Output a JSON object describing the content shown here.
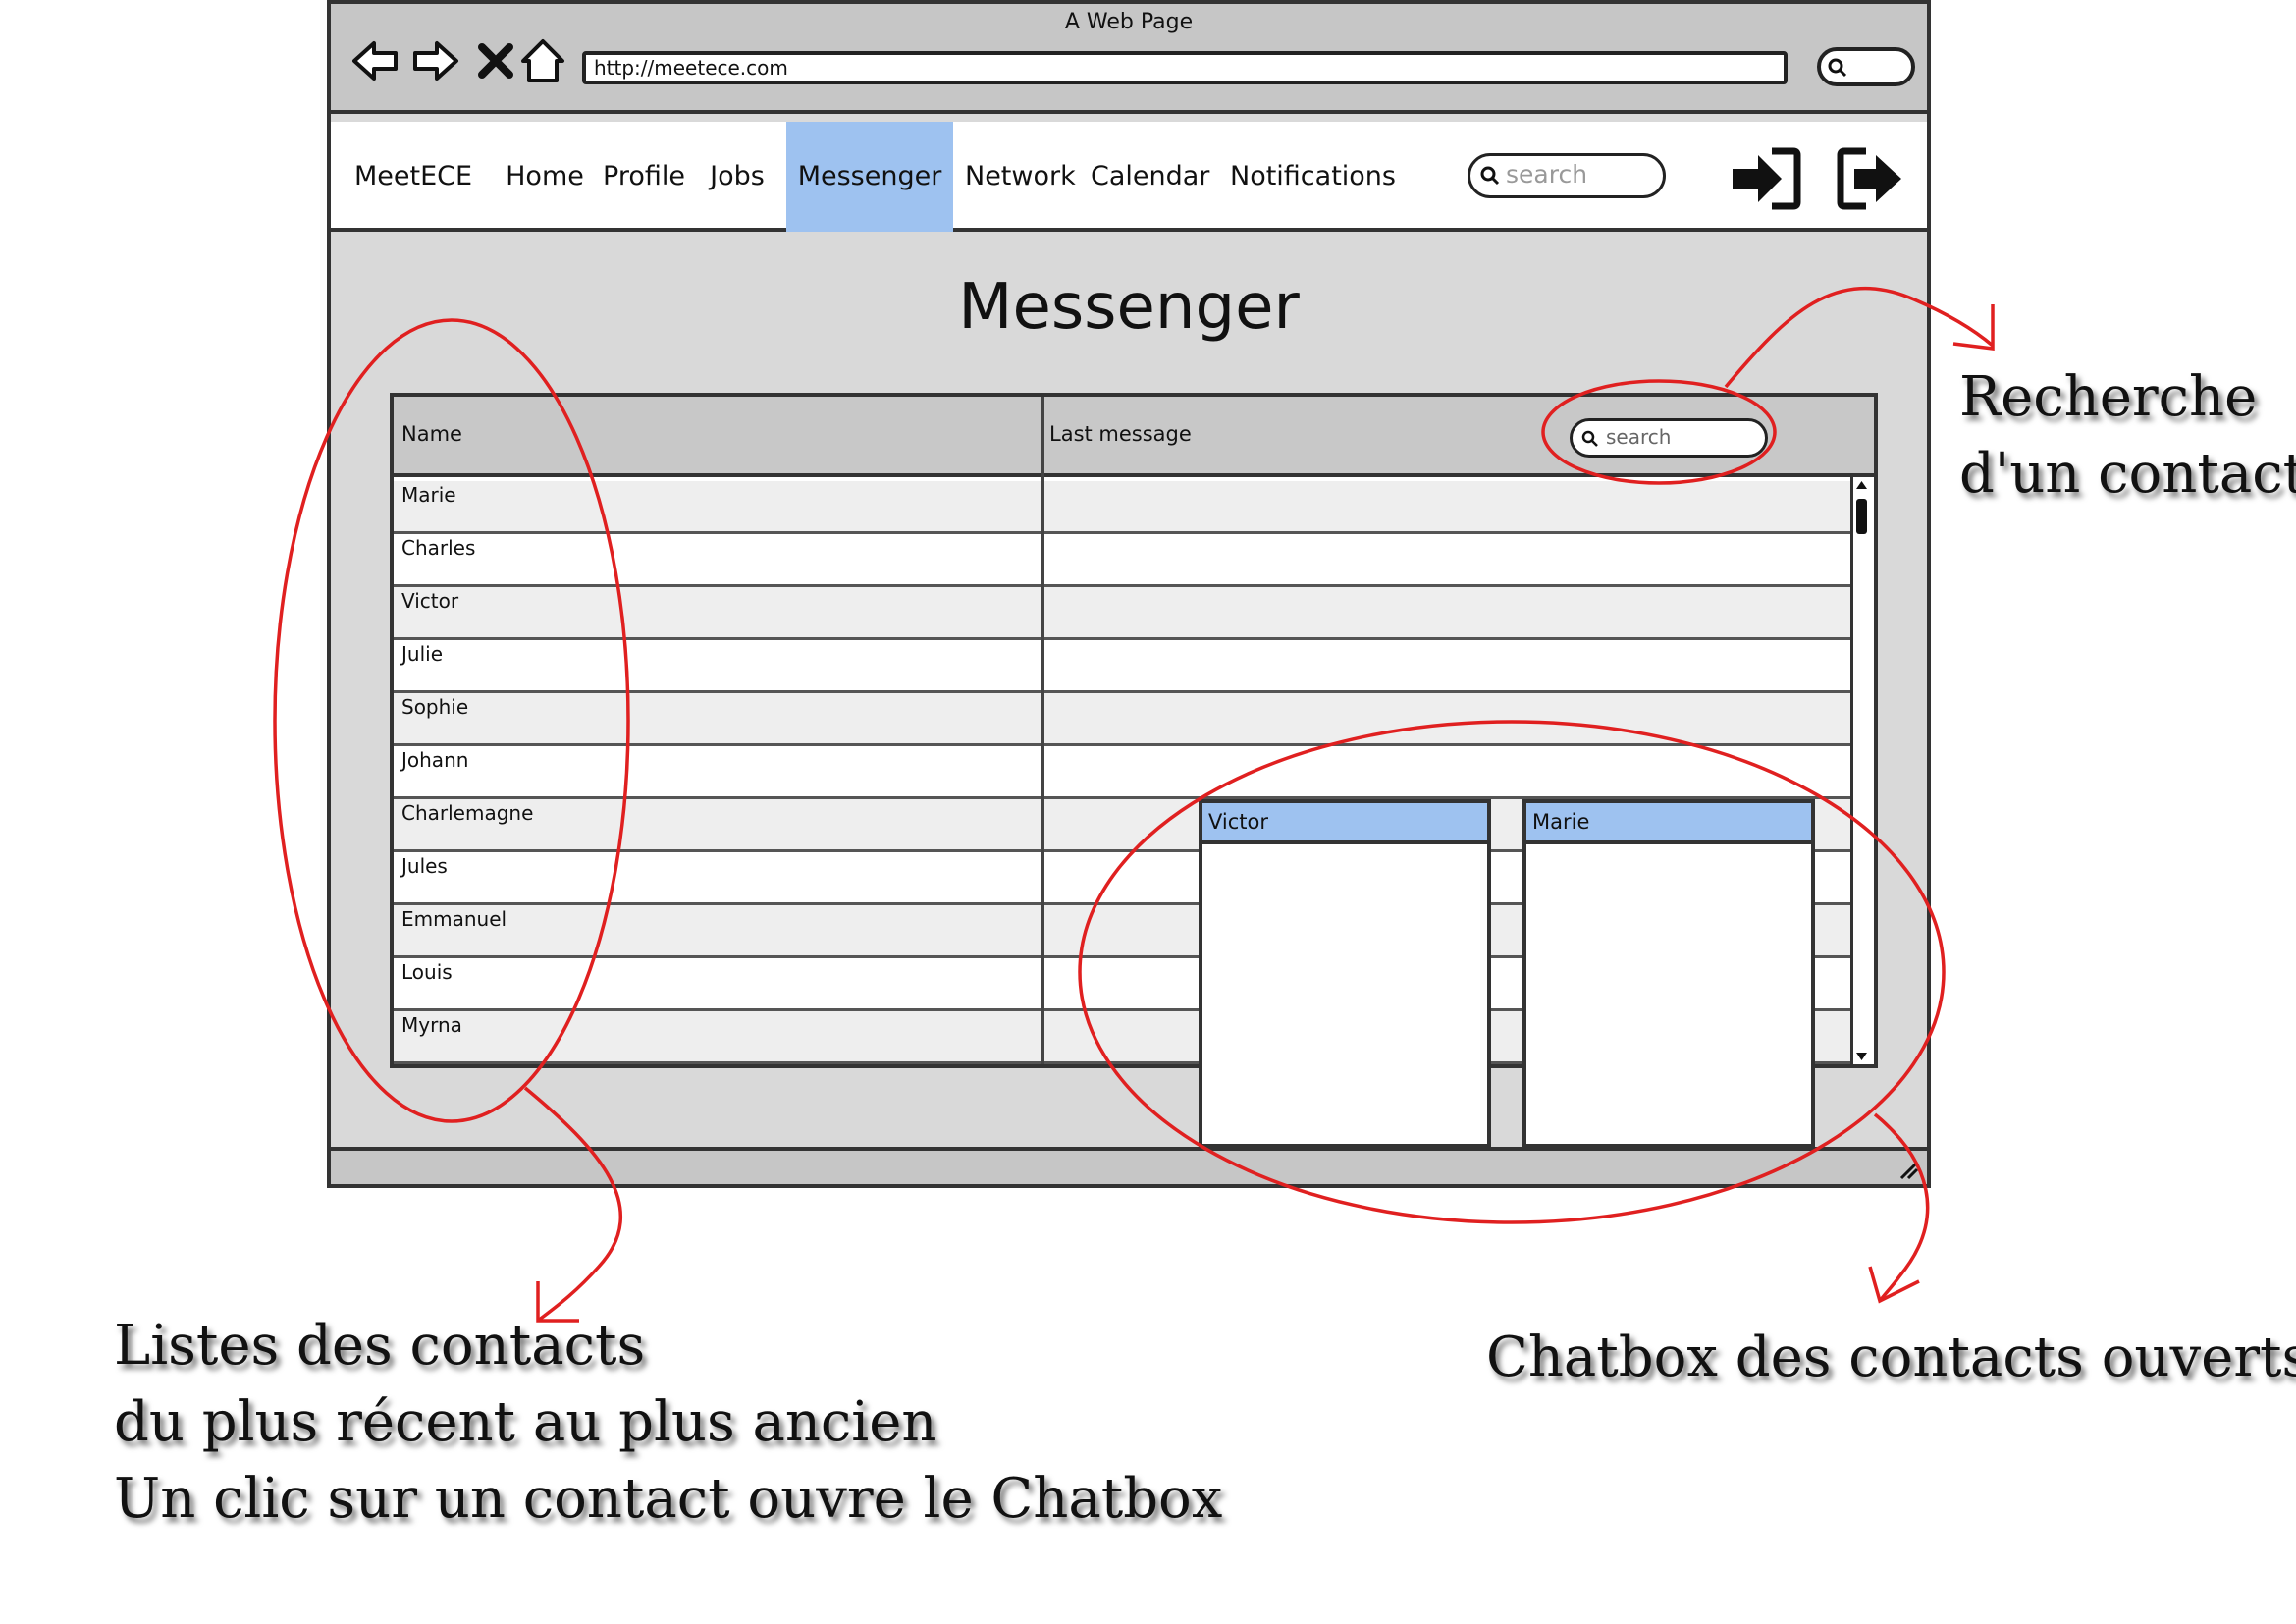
{
  "browser": {
    "title": "A Web Page",
    "url": "http://meetece.com",
    "nav_icons": [
      "back-arrow-icon",
      "forward-arrow-icon",
      "close-x-icon",
      "home-icon"
    ]
  },
  "navbar": {
    "brand": "MeetECE",
    "items": [
      "Home",
      "Profile",
      "Jobs",
      "Messenger",
      "Network",
      "Calendar",
      "Notifications"
    ],
    "active": "Messenger",
    "search_placeholder": "search",
    "icons": [
      "login-icon",
      "logout-icon"
    ]
  },
  "page": {
    "title": "Messenger",
    "table": {
      "columns": [
        "Name",
        "Last message"
      ],
      "search_placeholder": "search",
      "rows": [
        "Marie",
        "Charles",
        "Victor",
        "Julie",
        "Sophie",
        "Johann",
        "Charlemagne",
        "Jules",
        "Emmanuel",
        "Louis",
        "Myrna"
      ]
    },
    "chatboxes": [
      "Victor",
      "Marie"
    ]
  },
  "annotations": {
    "search": "Recherche\nd'un contact",
    "contacts": "Listes des contacts\ndu plus récent au plus ancien\nUn clic sur un contact ouvre le Chatbox",
    "chatbox": "Chatbox des contacts ouverts"
  },
  "colors": {
    "highlight": "#9ec2f0",
    "annotation": "#e02020",
    "chrome": "#c6c6c6",
    "canvas": "#d9d9d9"
  }
}
